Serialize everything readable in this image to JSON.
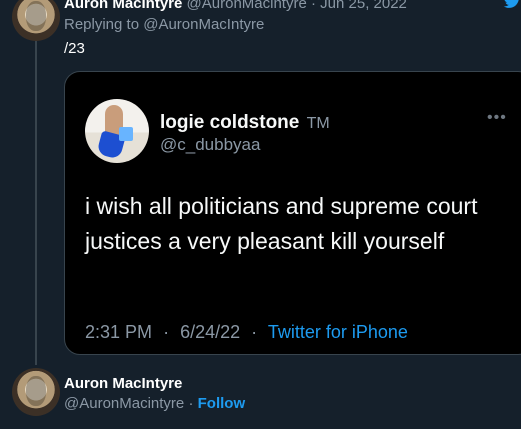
{
  "top_tweet": {
    "author_name": "Auron MacIntyre",
    "author_handle": "@AuronMacintyre",
    "separator": "·",
    "date": "Jun 25, 2022",
    "replying_prefix": "Replying to",
    "replying_handle": "@AuronMacIntyre",
    "thread_index": "/23"
  },
  "quoted_tweet": {
    "name": "logie coldstone",
    "name_mark": "TM",
    "handle": "@c_dubbyaa",
    "text": "i wish all politicians and supreme court justices a very pleasant kill yourself",
    "time": "2:31 PM",
    "date": "6/24/22",
    "separator": "·",
    "source": "Twitter for iPhone",
    "more_icon": "more-horizontal-icon"
  },
  "bottom_tweet": {
    "author_name": "Auron MacIntyre",
    "author_handle": "@AuronMacintyre",
    "separator": "·",
    "follow_label": "Follow"
  },
  "icons": {
    "brand": "twitter-bird-icon"
  },
  "colors": {
    "background": "#15202b",
    "card_background": "#000000",
    "accent": "#1d9bf0",
    "muted_text": "#8b98a5",
    "border": "#38444d"
  }
}
